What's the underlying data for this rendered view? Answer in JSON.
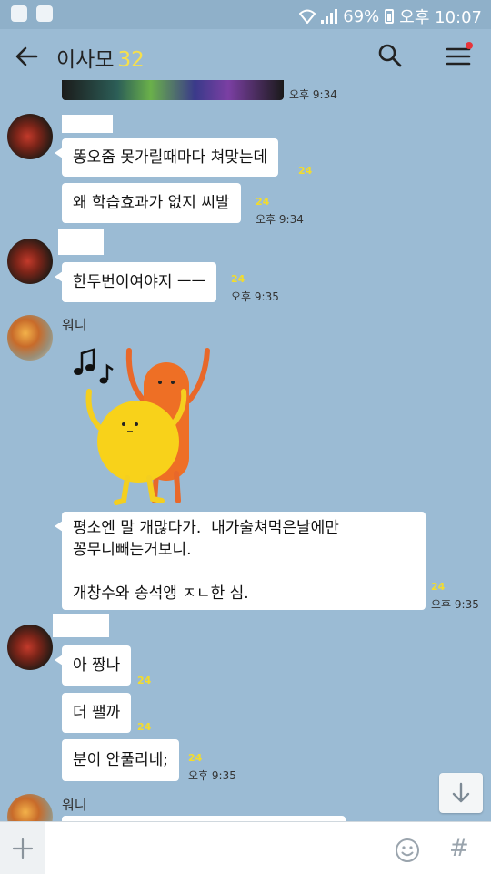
{
  "status_bar": {
    "battery": "69%",
    "time": "오후 10:07"
  },
  "header": {
    "title": "이사모",
    "member_count": "32"
  },
  "messages": [
    {
      "time": "오후 9:34"
    },
    {
      "text": "똥오줌 못가릴때마다 쳐맞는데",
      "unread": "24"
    },
    {
      "text": "왜 학습효과가 없지 씨발",
      "unread": "24",
      "time": "오후 9:34"
    },
    {
      "text": "한두번이여야지 ㅡㅡ",
      "unread": "24",
      "time": "오후 9:35"
    },
    {
      "sender": "워니"
    },
    {
      "text": "평소엔 말 개많다가.  내가술쳐먹은날에만\n꽁무니빼는거보니.\n\n개창수와 송석앵 ㅈㄴ한 심.",
      "unread": "24",
      "time": "오후 9:35"
    },
    {
      "text": "아 짱나",
      "unread": "24"
    },
    {
      "text": "더 팰까",
      "unread": "24"
    },
    {
      "text": "분이 안풀리네;",
      "unread": "24",
      "time": "오후 9:35"
    },
    {
      "sender": "워니"
    }
  ],
  "input": {
    "placeholder": ""
  }
}
